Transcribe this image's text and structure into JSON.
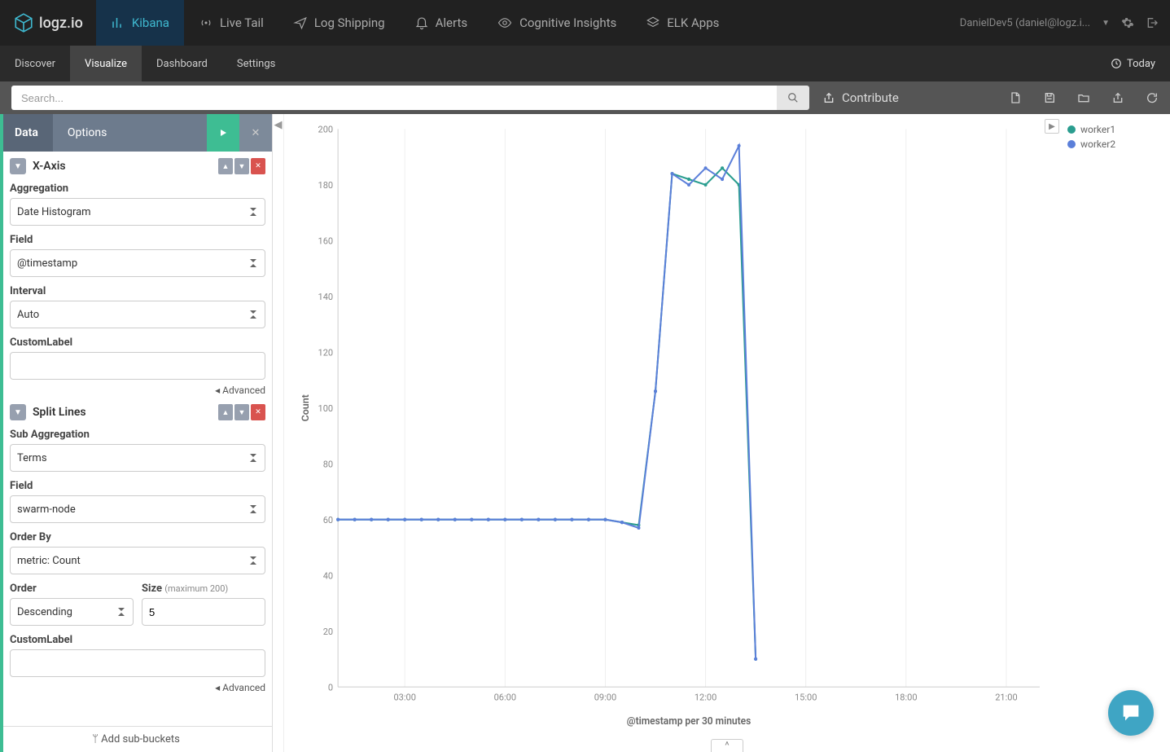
{
  "brand": "logz.io",
  "topnav": [
    {
      "label": "Kibana",
      "active": true
    },
    {
      "label": "Live Tail"
    },
    {
      "label": "Log Shipping"
    },
    {
      "label": "Alerts"
    },
    {
      "label": "Cognitive Insights"
    },
    {
      "label": "ELK Apps"
    }
  ],
  "user_label": "DanielDev5 (daniel@logz.i...",
  "subnav": [
    {
      "label": "Discover"
    },
    {
      "label": "Visualize",
      "active": true
    },
    {
      "label": "Dashboard"
    },
    {
      "label": "Settings"
    }
  ],
  "timerange": "Today",
  "search": {
    "placeholder": "Search..."
  },
  "contribute": "Contribute",
  "sidebar_tabs": {
    "data": "Data",
    "options": "Options"
  },
  "xaxis": {
    "title": "X-Axis",
    "agg_label": "Aggregation",
    "agg_value": "Date Histogram",
    "field_label": "Field",
    "field_value": "@timestamp",
    "interval_label": "Interval",
    "interval_value": "Auto",
    "custom_label": "CustomLabel",
    "advanced": "Advanced"
  },
  "split": {
    "title": "Split Lines",
    "subagg_label": "Sub Aggregation",
    "subagg_value": "Terms",
    "field_label": "Field",
    "field_value": "swarm-node",
    "orderby_label": "Order By",
    "orderby_value": "metric: Count",
    "order_label": "Order",
    "order_value": "Descending",
    "size_label": "Size",
    "size_note": "(maximum 200)",
    "size_value": "5",
    "custom_label": "CustomLabel",
    "advanced": "Advanced"
  },
  "add_sub": "Add sub-buckets",
  "chart_data": {
    "type": "line",
    "xlabel": "@timestamp per 30 minutes",
    "ylabel": "Count",
    "ylim": [
      0,
      200
    ],
    "yticks": [
      0,
      20,
      40,
      60,
      80,
      100,
      120,
      140,
      160,
      180,
      200
    ],
    "xticks": [
      "03:00",
      "06:00",
      "09:00",
      "12:00",
      "15:00",
      "18:00",
      "21:00"
    ],
    "x": [
      "01:00",
      "01:30",
      "02:00",
      "02:30",
      "03:00",
      "03:30",
      "04:00",
      "04:30",
      "05:00",
      "05:30",
      "06:00",
      "06:30",
      "07:00",
      "07:30",
      "08:00",
      "08:30",
      "09:00",
      "09:30",
      "10:00",
      "10:30",
      "11:00",
      "11:30",
      "12:00",
      "12:30",
      "13:00",
      "13:30"
    ],
    "series": [
      {
        "name": "worker1",
        "color": "#2a9d8f",
        "values": [
          60,
          60,
          60,
          60,
          60,
          60,
          60,
          60,
          60,
          60,
          60,
          60,
          60,
          60,
          60,
          60,
          60,
          59,
          58,
          106,
          184,
          182,
          180,
          186,
          180,
          10
        ]
      },
      {
        "name": "worker2",
        "color": "#5b7fd9",
        "values": [
          60,
          60,
          60,
          60,
          60,
          60,
          60,
          60,
          60,
          60,
          60,
          60,
          60,
          60,
          60,
          60,
          60,
          59,
          57,
          106,
          184,
          180,
          186,
          182,
          194,
          10
        ]
      }
    ]
  }
}
